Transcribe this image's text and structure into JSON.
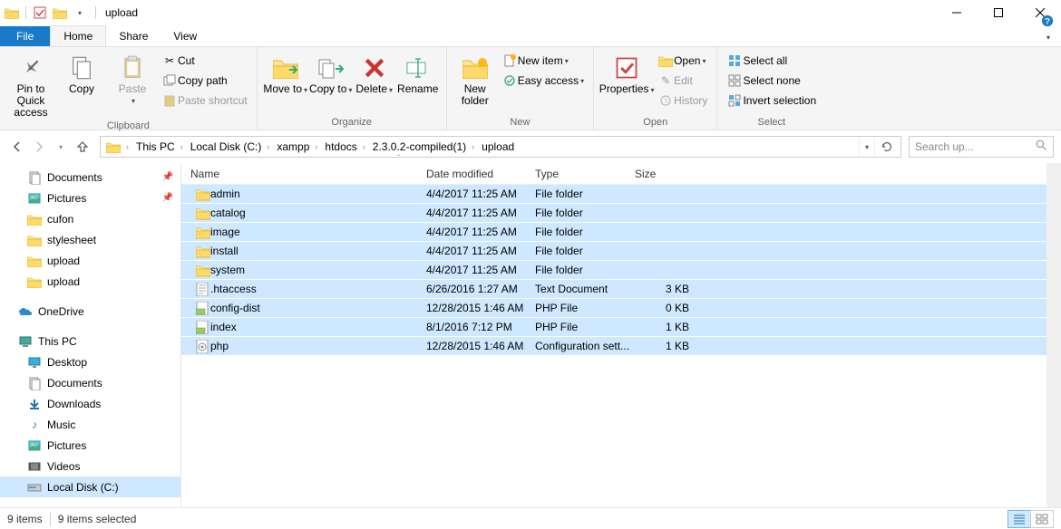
{
  "title": "upload",
  "tabs": {
    "file": "File",
    "home": "Home",
    "share": "Share",
    "view": "View"
  },
  "ribbon": {
    "clipboard": {
      "label": "Clipboard",
      "pin": "Pin to Quick access",
      "copy": "Copy",
      "paste": "Paste",
      "cut": "Cut",
      "copypath": "Copy path",
      "pasteshort": "Paste shortcut"
    },
    "organize": {
      "label": "Organize",
      "moveto": "Move to",
      "copyto": "Copy to",
      "delete": "Delete",
      "rename": "Rename"
    },
    "new": {
      "label": "New",
      "newfolder": "New folder",
      "newitem": "New item",
      "easyaccess": "Easy access"
    },
    "open": {
      "label": "Open",
      "properties": "Properties",
      "open": "Open",
      "edit": "Edit",
      "history": "History"
    },
    "select": {
      "label": "Select",
      "all": "Select all",
      "none": "Select none",
      "invert": "Invert selection"
    }
  },
  "breadcrumbs": [
    "This PC",
    "Local Disk (C:)",
    "xampp",
    "htdocs",
    "2.3.0.2-compiled(1)",
    "upload"
  ],
  "search_placeholder": "Search up...",
  "nav": {
    "documents": "Documents",
    "pictures": "Pictures",
    "cufon": "cufon",
    "stylesheet": "stylesheet",
    "upload1": "upload",
    "upload2": "upload",
    "onedrive": "OneDrive",
    "thispc": "This PC",
    "desktop": "Desktop",
    "documents2": "Documents",
    "downloads": "Downloads",
    "music": "Music",
    "pictures2": "Pictures",
    "videos": "Videos",
    "localdisk": "Local Disk (C:)"
  },
  "columns": {
    "name": "Name",
    "date": "Date modified",
    "type": "Type",
    "size": "Size"
  },
  "files": [
    {
      "name": "admin",
      "date": "4/4/2017 11:25 AM",
      "type": "File folder",
      "size": "",
      "icon": "folder"
    },
    {
      "name": "catalog",
      "date": "4/4/2017 11:25 AM",
      "type": "File folder",
      "size": "",
      "icon": "folder"
    },
    {
      "name": "image",
      "date": "4/4/2017 11:25 AM",
      "type": "File folder",
      "size": "",
      "icon": "folder"
    },
    {
      "name": "install",
      "date": "4/4/2017 11:25 AM",
      "type": "File folder",
      "size": "",
      "icon": "folder"
    },
    {
      "name": "system",
      "date": "4/4/2017 11:25 AM",
      "type": "File folder",
      "size": "",
      "icon": "folder"
    },
    {
      "name": ".htaccess",
      "date": "6/26/2016 1:27 AM",
      "type": "Text Document",
      "size": "3 KB",
      "icon": "text"
    },
    {
      "name": "config-dist",
      "date": "12/28/2015 1:46 AM",
      "type": "PHP File",
      "size": "0 KB",
      "icon": "php"
    },
    {
      "name": "index",
      "date": "8/1/2016 7:12 PM",
      "type": "PHP File",
      "size": "1 KB",
      "icon": "php"
    },
    {
      "name": "php",
      "date": "12/28/2015 1:46 AM",
      "type": "Configuration sett...",
      "size": "1 KB",
      "icon": "ini"
    }
  ],
  "status": {
    "items": "9 items",
    "selected": "9 items selected"
  }
}
